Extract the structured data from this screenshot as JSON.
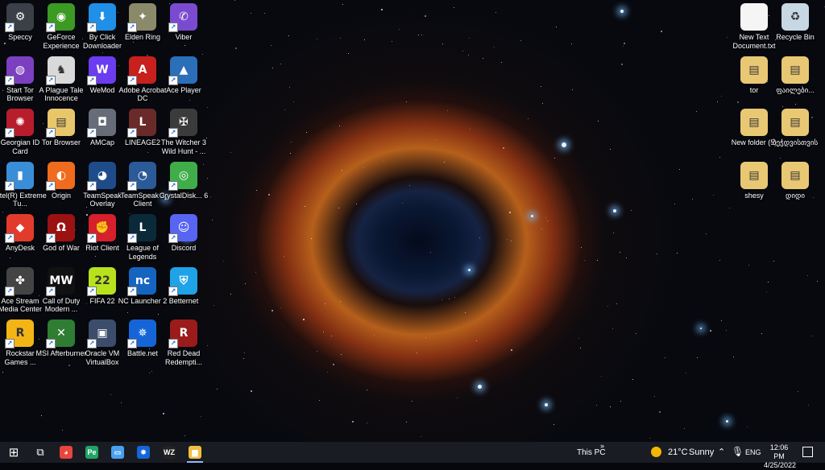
{
  "desktop": {
    "icons": [
      {
        "label": "Speccy",
        "glyph": "⚙",
        "color": "#3a3f48",
        "icon": "speccy-icon"
      },
      {
        "label": "GeForce Experience",
        "glyph": "◉",
        "color": "#3a9a22",
        "icon": "nvidia-icon"
      },
      {
        "label": "By Click Downloader",
        "glyph": "⬇",
        "color": "#1f8fe8",
        "icon": "download-icon"
      },
      {
        "label": "Elden Ring",
        "glyph": "✦",
        "color": "#8a8a6a",
        "icon": "elden-ring-icon"
      },
      {
        "label": "Viber",
        "glyph": "✆",
        "color": "#7a4bd0",
        "icon": "viber-icon"
      },
      {
        "label": "Start Tor Browser",
        "glyph": "◍",
        "color": "#7b3fc0",
        "icon": "tor-icon"
      },
      {
        "label": "A Plague Tale Innocence",
        "glyph": "♞",
        "color": "#d9d9d9",
        "icon": "plague-tale-icon"
      },
      {
        "label": "WeMod",
        "glyph": "W",
        "color": "#6b3cf0",
        "icon": "wemod-icon"
      },
      {
        "label": "Adobe Acrobat DC",
        "glyph": "A",
        "color": "#c8201c",
        "icon": "acrobat-icon"
      },
      {
        "label": "Ace Player",
        "glyph": "▲",
        "color": "#2b6fb8",
        "icon": "ace-player-icon"
      },
      {
        "label": "Georgian ID Card",
        "glyph": "✺",
        "color": "#b81d2c",
        "icon": "id-card-icon"
      },
      {
        "label": "Tor Browser",
        "glyph": "▤",
        "color": "#e8c66a",
        "icon": "folder-icon"
      },
      {
        "label": "AMCap",
        "glyph": "◘",
        "color": "#666d78",
        "icon": "camera-icon"
      },
      {
        "label": "LINEAGE2",
        "glyph": "L",
        "color": "#6a2a2a",
        "icon": "lineage-icon"
      },
      {
        "label": "The Witcher 3 Wild Hunt - ...",
        "glyph": "✠",
        "color": "#3b3b3b",
        "icon": "witcher-icon"
      },
      {
        "label": "Intel(R) Extreme Tu...",
        "glyph": "▮",
        "color": "#3a8ed8",
        "icon": "intel-icon"
      },
      {
        "label": "Origin",
        "glyph": "◐",
        "color": "#f06b1e",
        "icon": "origin-icon"
      },
      {
        "label": "TeamSpeak Overlay",
        "glyph": "◕",
        "color": "#1e4c8a",
        "icon": "teamspeak-icon"
      },
      {
        "label": "TeamSpeak 3 Client",
        "glyph": "◔",
        "color": "#2a5a98",
        "icon": "teamspeak-icon"
      },
      {
        "label": "CrystalDisk... 6",
        "glyph": "◎",
        "color": "#3fae4a",
        "icon": "crystaldisk-icon"
      },
      {
        "label": "AnyDesk",
        "glyph": "◆",
        "color": "#e23b2c",
        "icon": "anydesk-icon"
      },
      {
        "label": "God of War",
        "glyph": "Ω",
        "color": "#9b1212",
        "icon": "god-of-war-icon"
      },
      {
        "label": "Riot Client",
        "glyph": "✊",
        "color": "#d6202b",
        "icon": "riot-icon"
      },
      {
        "label": "League of Legends",
        "glyph": "L",
        "color": "#0a2a3a",
        "icon": "league-icon"
      },
      {
        "label": "Discord",
        "glyph": "☺",
        "color": "#5865f2",
        "icon": "discord-icon"
      },
      {
        "label": "Ace Stream Media Center",
        "glyph": "✤",
        "color": "#444",
        "icon": "ace-stream-icon"
      },
      {
        "label": "Call of Duty Modern ...",
        "glyph": "MW",
        "color": "#111",
        "icon": "cod-icon"
      },
      {
        "label": "FIFA 22",
        "glyph": "22",
        "color": "#b8e21c",
        "icon": "fifa-icon"
      },
      {
        "label": "NC Launcher 2",
        "glyph": "nc",
        "color": "#1565c0",
        "icon": "nc-launcher-icon"
      },
      {
        "label": "Betternet",
        "glyph": "⛨",
        "color": "#1fa3e8",
        "icon": "betternet-icon"
      },
      {
        "label": "Rockstar Games ...",
        "glyph": "R",
        "color": "#f3b516",
        "icon": "rockstar-icon"
      },
      {
        "label": "MSI Afterburner",
        "glyph": "✕",
        "color": "#2e7d32",
        "icon": "afterburner-icon"
      },
      {
        "label": "Oracle VM VirtualBox",
        "glyph": "▣",
        "color": "#3b4d6a",
        "icon": "virtualbox-icon"
      },
      {
        "label": "Battle.net",
        "glyph": "✵",
        "color": "#1565d8",
        "icon": "battlenet-icon"
      },
      {
        "label": "Red Dead Redempti...",
        "glyph": "R",
        "color": "#9b1b1b",
        "icon": "red-dead-icon"
      },
      {
        "label": "New Text Document.txt",
        "glyph": "",
        "color": "#f5f5f5",
        "icon": "text-document-icon"
      },
      {
        "label": "Recycle Bin",
        "glyph": "♻",
        "color": "#c7d7e3",
        "icon": "recycle-bin-icon"
      },
      {
        "label": "tor",
        "glyph": "▤",
        "color": "#e9c874",
        "icon": "folder-icon"
      },
      {
        "label": "ფაილები...",
        "glyph": "▤",
        "color": "#e9c874",
        "icon": "folder-icon"
      },
      {
        "label": "New folder (5)",
        "glyph": "▤",
        "color": "#e9c874",
        "icon": "folder-icon"
      },
      {
        "label": "ბეჭდვისთვის",
        "glyph": "▤",
        "color": "#e9c874",
        "icon": "folder-icon"
      },
      {
        "label": "shesy",
        "glyph": "▤",
        "color": "#e9c874",
        "icon": "folder-icon"
      },
      {
        "label": "დიდი",
        "glyph": "▤",
        "color": "#e9c874",
        "icon": "folder-icon"
      }
    ]
  },
  "taskbar": {
    "start_glyph": "⊞",
    "taskview_glyph": "⧉",
    "apps": [
      {
        "glyph": "◕",
        "color": "#e8453c",
        "icon": "chrome-icon"
      },
      {
        "glyph": "Pe",
        "color": "#21a366",
        "icon": "publisher-icon"
      },
      {
        "glyph": "▭",
        "color": "#4aa0f0",
        "icon": "desktop-icon"
      },
      {
        "glyph": "✵",
        "color": "#1565d8",
        "icon": "battlenet-icon"
      },
      {
        "glyph": "WZ",
        "color": "#222",
        "icon": "warzone-icon"
      },
      {
        "glyph": "▆",
        "color": "#f0c040",
        "icon": "file-explorer-icon"
      }
    ],
    "this_pc": "This PC",
    "weather_temp": "21°C",
    "weather_cond": "Sunny",
    "language": "ENG",
    "time": "12:06 PM",
    "date": "4/25/2022"
  }
}
